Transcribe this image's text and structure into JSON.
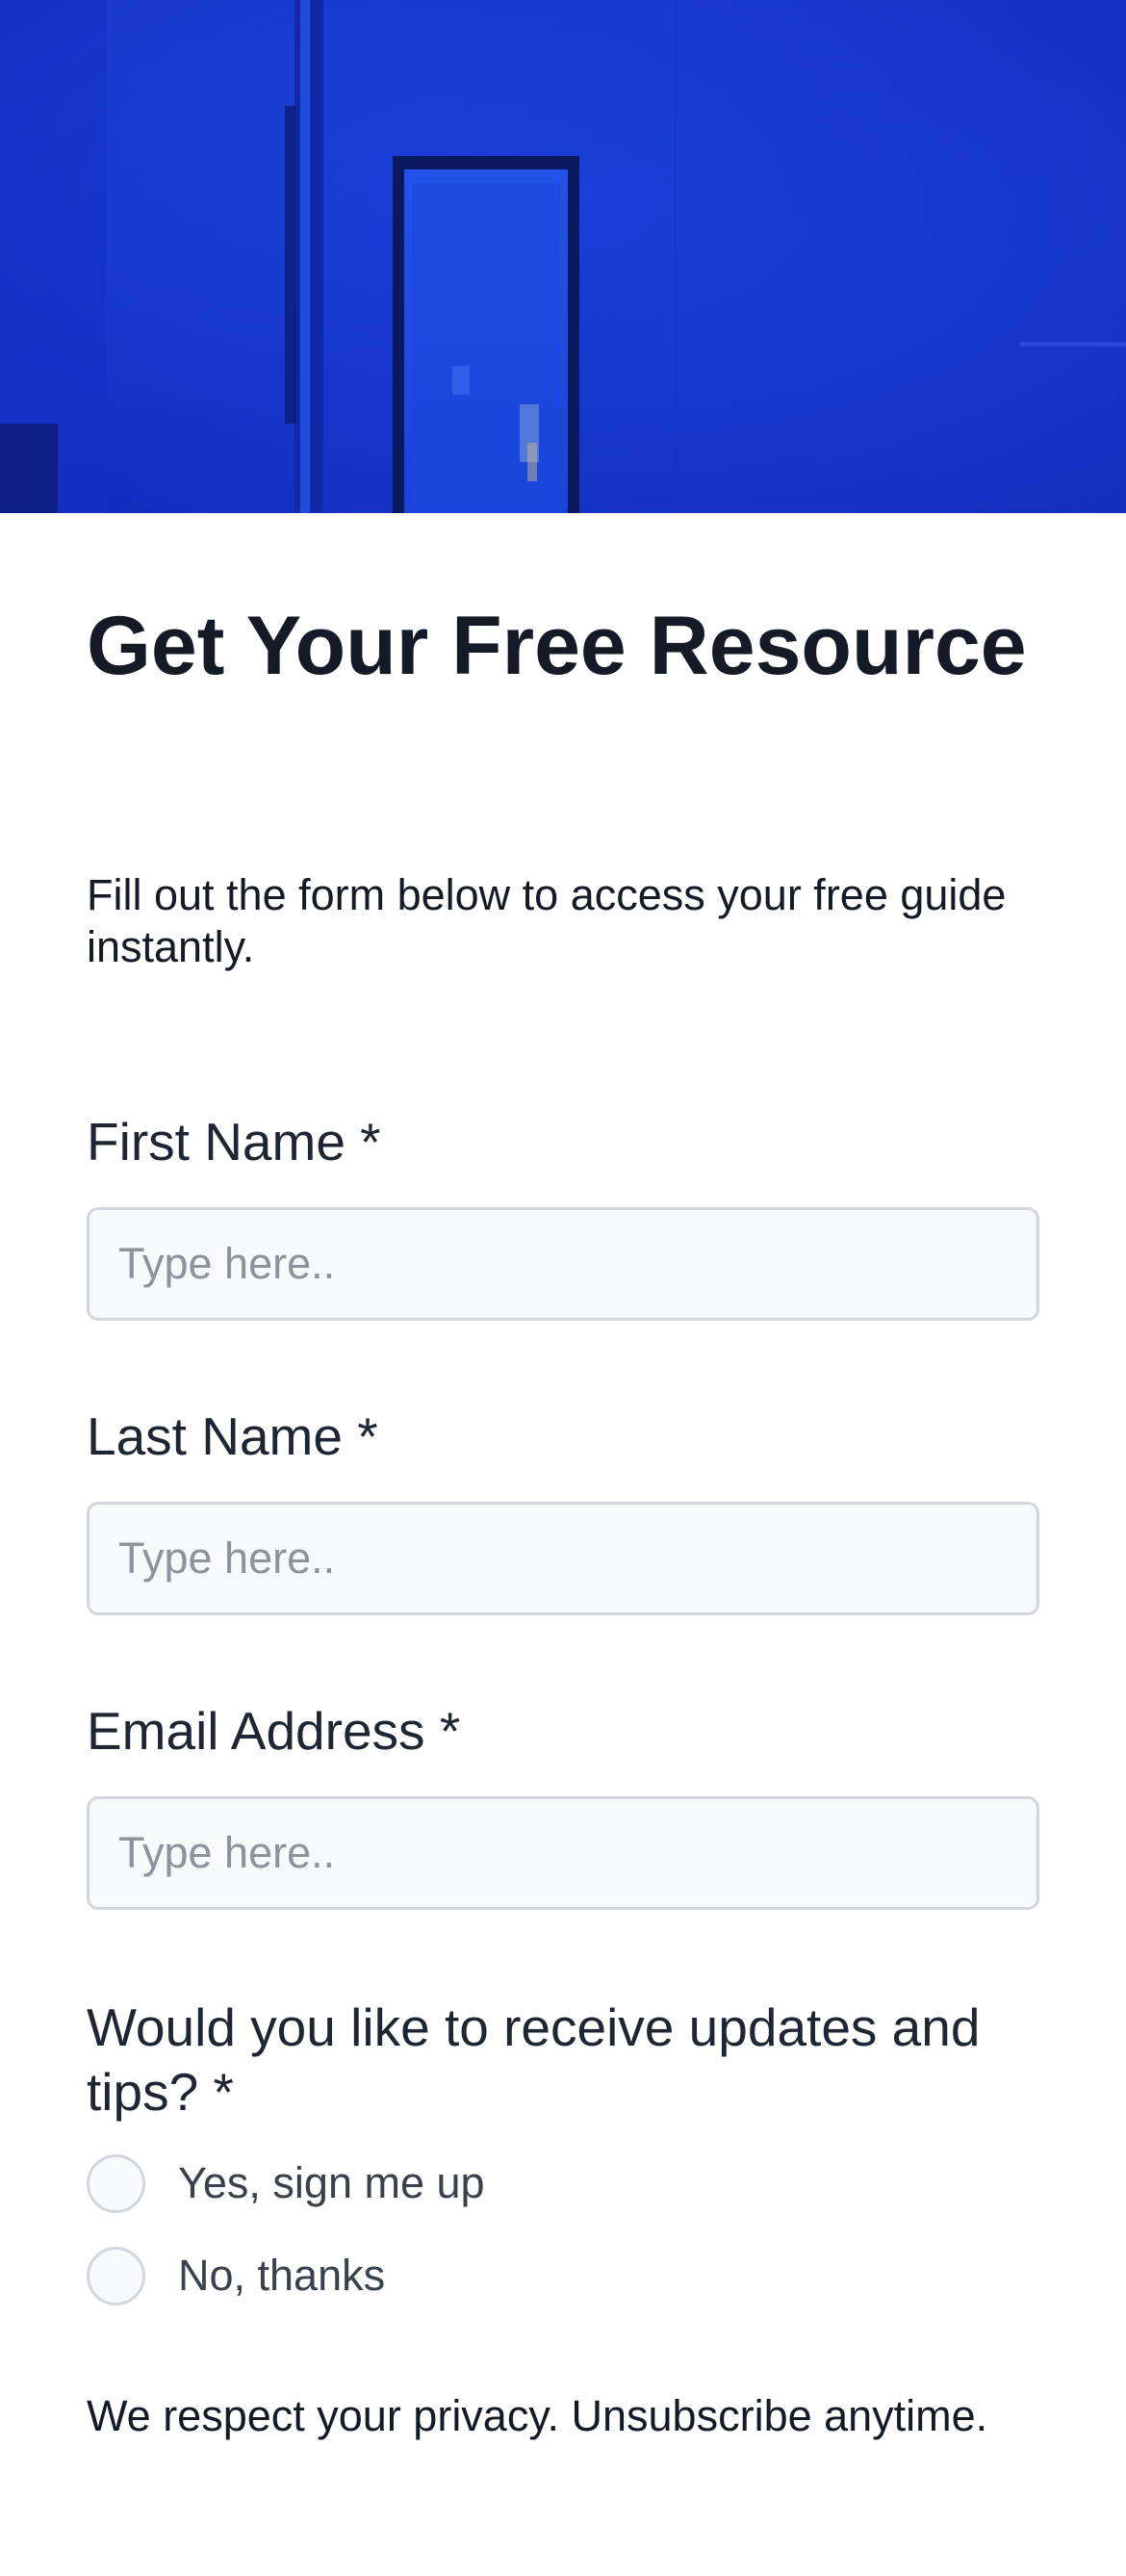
{
  "hero": {
    "image_icon": "blue-wall-door-photo",
    "colors": {
      "wall": "#1535d8",
      "door": "#1f4ee0",
      "frame": "#0b1a5e"
    }
  },
  "form": {
    "title": "Get Your Free Resource",
    "intro": "Fill out the form below to access your free guide instantly.",
    "fields": [
      {
        "label": "First Name *",
        "placeholder": "Type here..",
        "value": ""
      },
      {
        "label": "Last Name *",
        "placeholder": "Type here..",
        "value": ""
      },
      {
        "label": "Email Address *",
        "placeholder": "Type here..",
        "value": ""
      }
    ],
    "updates": {
      "question": "Would you like to receive updates and tips? *",
      "options": [
        "Yes, sign me up",
        "No, thanks"
      ],
      "selected": null
    },
    "privacy_note": "We respect your privacy. Unsubscribe anytime."
  }
}
